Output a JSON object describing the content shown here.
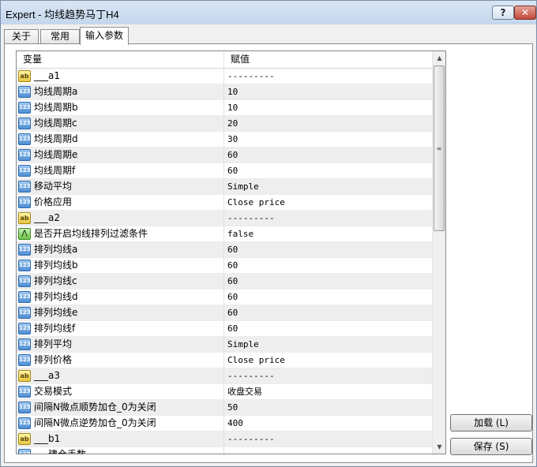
{
  "window": {
    "title": "Expert - 均线趋势马丁H4",
    "help_glyph": "?",
    "close_glyph": "✕"
  },
  "tabs": [
    {
      "label": "关于",
      "active": false
    },
    {
      "label": "常用",
      "active": false
    },
    {
      "label": "输入参数",
      "active": true
    }
  ],
  "table": {
    "header_name": "变量",
    "header_value": "赋值",
    "rows": [
      {
        "icon": "string-icon",
        "name": "___a1",
        "value": "---------"
      },
      {
        "icon": "number-icon",
        "name": "均线周期a",
        "value": "10"
      },
      {
        "icon": "number-icon",
        "name": "均线周期b",
        "value": "10"
      },
      {
        "icon": "number-icon",
        "name": "均线周期c",
        "value": "20"
      },
      {
        "icon": "number-icon",
        "name": "均线周期d",
        "value": "30"
      },
      {
        "icon": "number-icon",
        "name": "均线周期e",
        "value": "60"
      },
      {
        "icon": "number-icon",
        "name": "均线周期f",
        "value": "60"
      },
      {
        "icon": "number-icon",
        "name": "移动平均",
        "value": "Simple"
      },
      {
        "icon": "number-icon",
        "name": "价格应用",
        "value": "Close price"
      },
      {
        "icon": "string-icon",
        "name": "___a2",
        "value": "---------"
      },
      {
        "icon": "bool-icon",
        "name": "是否开启均线排列过滤条件",
        "value": "false"
      },
      {
        "icon": "number-icon",
        "name": "排列均线a",
        "value": "60"
      },
      {
        "icon": "number-icon",
        "name": "排列均线b",
        "value": "60"
      },
      {
        "icon": "number-icon",
        "name": "排列均线c",
        "value": "60"
      },
      {
        "icon": "number-icon",
        "name": "排列均线d",
        "value": "60"
      },
      {
        "icon": "number-icon",
        "name": "排列均线e",
        "value": "60"
      },
      {
        "icon": "number-icon",
        "name": "排列均线f",
        "value": "60"
      },
      {
        "icon": "number-icon",
        "name": "排列平均",
        "value": "Simple"
      },
      {
        "icon": "number-icon",
        "name": "排列价格",
        "value": "Close price"
      },
      {
        "icon": "string-icon",
        "name": "___a3",
        "value": "---------"
      },
      {
        "icon": "number-icon",
        "name": "交易模式",
        "value": "收盘交易"
      },
      {
        "icon": "number-icon",
        "name": "间隔N微点顺势加仓_0为关闭",
        "value": "50"
      },
      {
        "icon": "number-icon",
        "name": "间隔N微点逆势加仓_0为关闭",
        "value": "400"
      },
      {
        "icon": "string-icon",
        "name": "___b1",
        "value": "---------"
      },
      {
        "icon": "number-icon",
        "name": "___建仓手数",
        "value": ""
      }
    ]
  },
  "icon_glyphs": {
    "number-icon": "123",
    "string-icon": "ab",
    "bool-icon": "⋀"
  },
  "buttons": {
    "load": "加载 (L)",
    "save": "保存 (S)"
  },
  "scrollbar": {
    "up": "▲",
    "down": "▼",
    "grip": "≡"
  }
}
